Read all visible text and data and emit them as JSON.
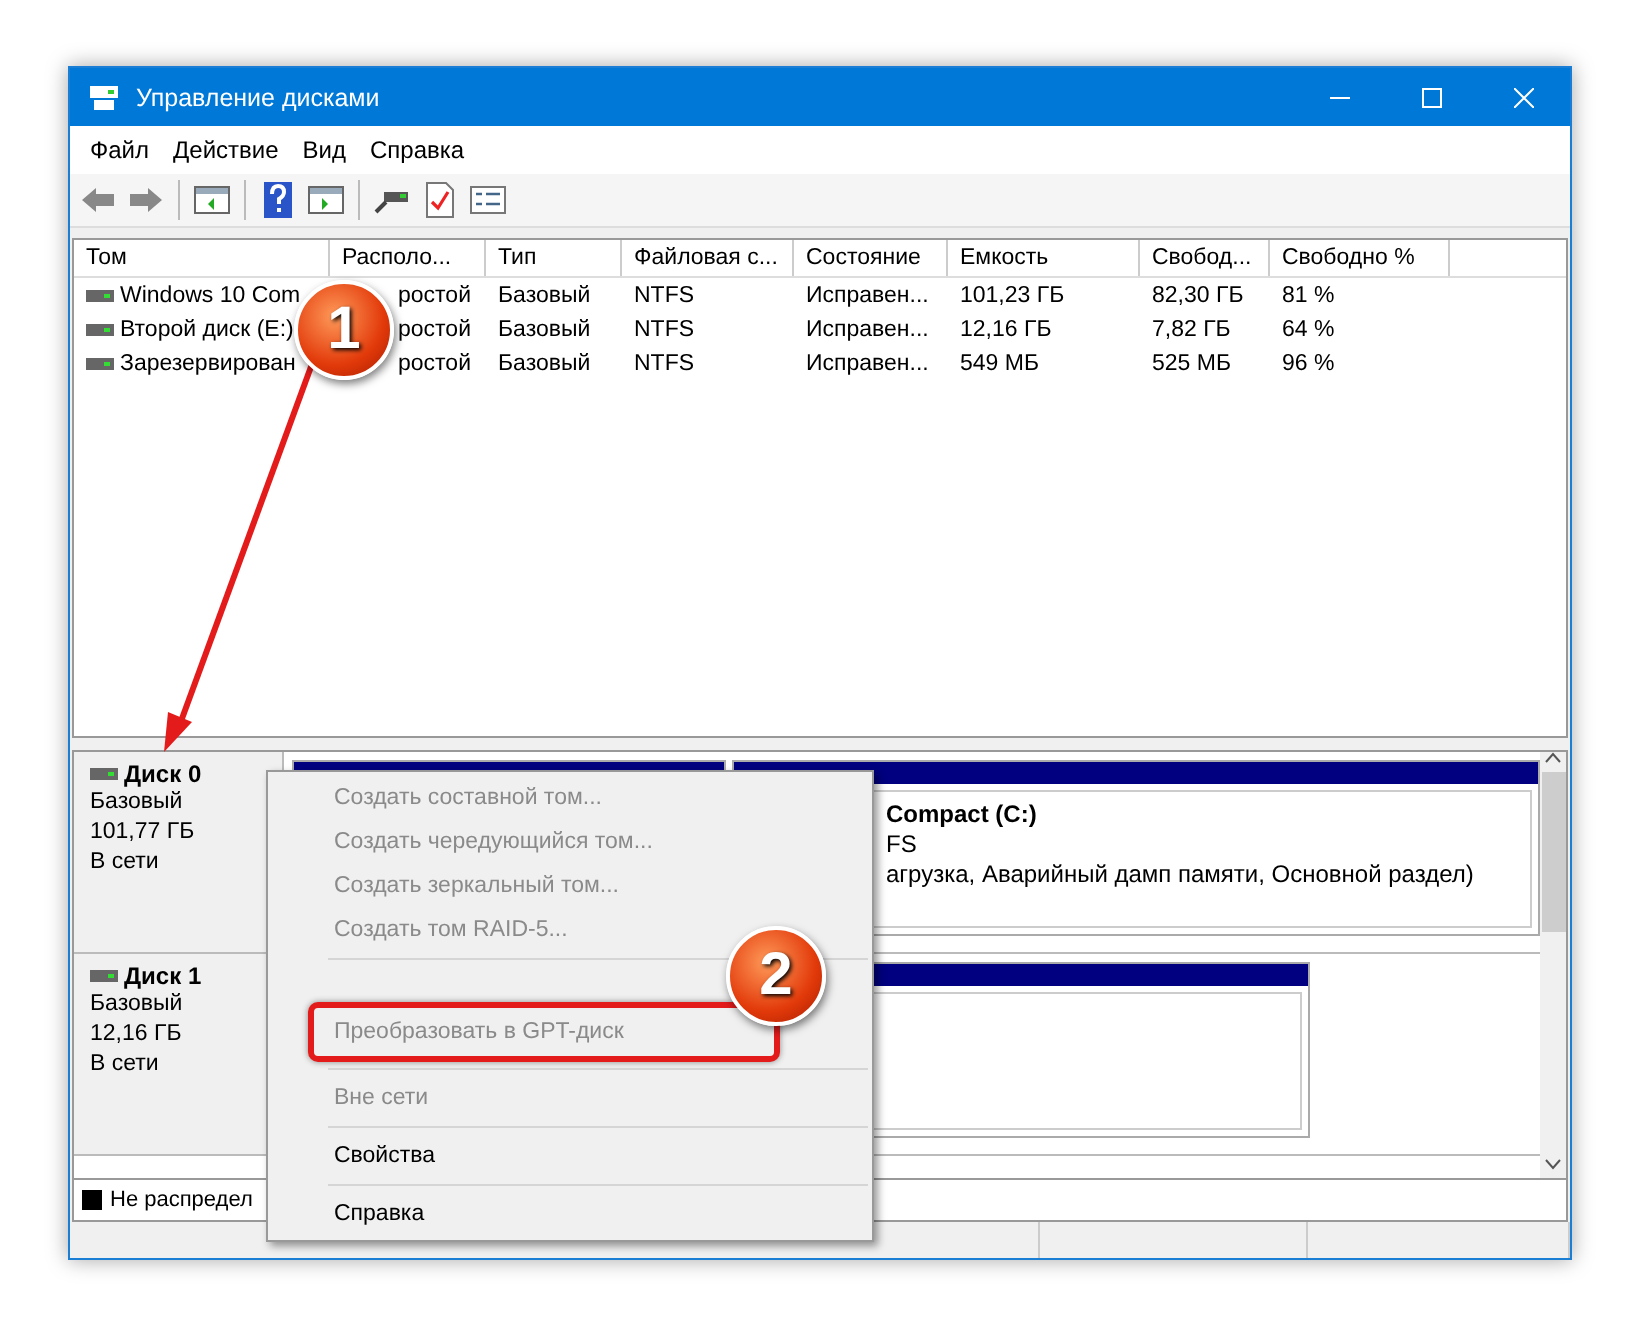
{
  "window": {
    "title": "Управление дисками"
  },
  "menu_bar": [
    "Файл",
    "Действие",
    "Вид",
    "Справка"
  ],
  "toolbar": [
    {
      "kind": "back"
    },
    {
      "kind": "forward"
    },
    {
      "kind": "sep"
    },
    {
      "kind": "panel"
    },
    {
      "kind": "sep"
    },
    {
      "kind": "help"
    },
    {
      "kind": "panel2"
    },
    {
      "kind": "sep"
    },
    {
      "kind": "drive"
    },
    {
      "kind": "check"
    },
    {
      "kind": "list"
    }
  ],
  "table": {
    "columns": [
      "Том",
      "Располо...",
      "Тип",
      "Файловая с...",
      "Состояние",
      "Емкость",
      "Свобод...",
      "Свободно %"
    ],
    "rows": [
      [
        "Windows 10 Com",
        "ростой",
        "Базовый",
        "NTFS",
        "Исправен...",
        "101,23 ГБ",
        "82,30 ГБ",
        "81 %"
      ],
      [
        "Второй диск (E:)",
        "ростой",
        "Базовый",
        "NTFS",
        "Исправен...",
        "12,16 ГБ",
        "7,82 ГБ",
        "64 %"
      ],
      [
        "Зарезервирован",
        "ростой",
        "Базовый",
        "NTFS",
        "Исправен...",
        "549 МБ",
        "525 МБ",
        "96 %"
      ]
    ]
  },
  "disks": [
    {
      "name": "Диск 0",
      "type": "Базовый",
      "size": "101,77 ГБ",
      "status": "В сети",
      "partitions": [
        {
          "kind": "covered"
        },
        {
          "kind": "volume",
          "lines": [
            "Compact  (C:)",
            "FS",
            "агрузка, Аварийный дамп памяти, Основной раздел)"
          ]
        }
      ]
    },
    {
      "name": "Диск 1",
      "type": "Базовый",
      "size": "12,16 ГБ",
      "status": "В сети",
      "partitions": [
        {
          "kind": "covered"
        }
      ]
    }
  ],
  "legend": [
    {
      "label": "Не распредел",
      "color": "#000000"
    }
  ],
  "context_menu": [
    {
      "kind": "item",
      "label": "Создать составной том...",
      "disabled": true,
      "highlighted": false
    },
    {
      "kind": "item",
      "label": "Создать чередующийся том...",
      "disabled": true,
      "highlighted": false
    },
    {
      "kind": "item",
      "label": "Создать зеркальный том...",
      "disabled": true,
      "highlighted": false
    },
    {
      "kind": "item",
      "label": "Создать том RAID-5...",
      "disabled": true,
      "highlighted": false
    },
    {
      "kind": "separator"
    },
    {
      "kind": "covered"
    },
    {
      "kind": "item",
      "label": "Преобразовать в GPT-диск",
      "disabled": true,
      "highlighted": true
    },
    {
      "kind": "separator"
    },
    {
      "kind": "item",
      "label": "Вне сети",
      "disabled": true,
      "highlighted": false
    },
    {
      "kind": "separator"
    },
    {
      "kind": "item",
      "label": "Свойства",
      "disabled": false,
      "highlighted": false
    },
    {
      "kind": "separator"
    },
    {
      "kind": "item",
      "label": "Справка",
      "disabled": false,
      "highlighted": false
    }
  ],
  "annotations": [
    "1",
    "2"
  ]
}
